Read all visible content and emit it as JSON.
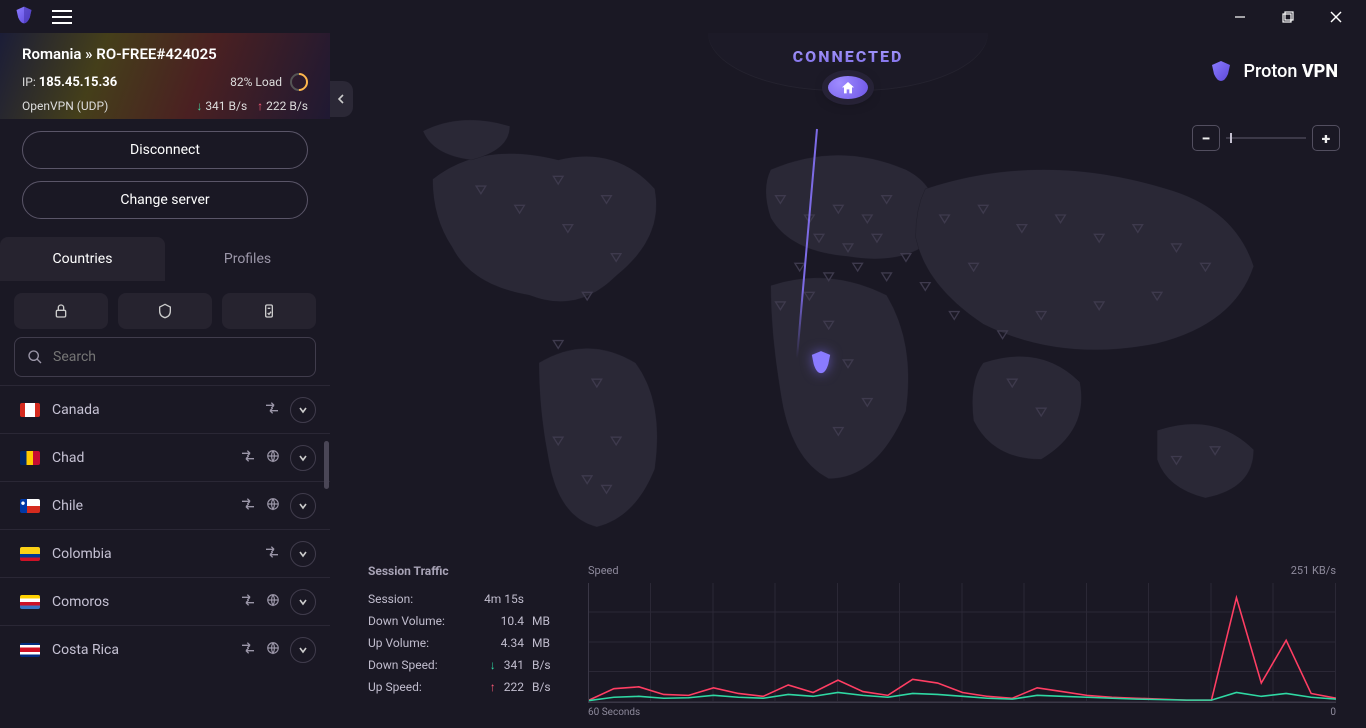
{
  "window": {
    "title": "Proton VPN"
  },
  "status": {
    "label": "CONNECTED",
    "breadcrumb_prefix": "Romania",
    "breadcrumb_sep": "»",
    "breadcrumb_server": "RO-FREE#424025",
    "ip_label": "IP:",
    "ip": "185.45.15.36",
    "load_text": "82% Load",
    "protocol": "OpenVPN (UDP)",
    "down_speed": "341 B/s",
    "up_speed": "222 B/s"
  },
  "buttons": {
    "disconnect": "Disconnect",
    "change_server": "Change server"
  },
  "tabs": {
    "countries": "Countries",
    "profiles": "Profiles",
    "active": "countries"
  },
  "filters": [
    "lock",
    "shield",
    "bolt"
  ],
  "search": {
    "placeholder": "Search"
  },
  "countries": [
    {
      "name": "Canada",
      "flag": "linear-gradient(90deg,#d52b1e 25%, #fff 25% 75%, #d52b1e 75%)",
      "p2p": true,
      "globe": false
    },
    {
      "name": "Chad",
      "flag": "linear-gradient(90deg,#002664 33%, #fecb00 33% 66%, #c60c30 66%)",
      "p2p": true,
      "globe": true
    },
    {
      "name": "Chile",
      "flag": "linear-gradient(180deg,#fff 50%, #d52b1e 50%)",
      "flag_overlay": "radial-gradient(circle at 15% 30%, #fff 1.5px, transparent 2px), linear-gradient(90deg,#0039a6 35%, transparent 35%)",
      "p2p": true,
      "globe": true
    },
    {
      "name": "Colombia",
      "flag": "linear-gradient(180deg,#fcd116 50%, #003893 50% 75%, #ce1126 75%)",
      "p2p": true,
      "globe": false
    },
    {
      "name": "Comoros",
      "flag": "linear-gradient(180deg,#ffd100 25%, #fff 25% 50%, #ce1126 50% 75%, #3a75c4 75%), linear-gradient(110deg,#3d8e33 35%, transparent 35%)",
      "p2p": true,
      "globe": true
    },
    {
      "name": "Costa Rica",
      "flag": "linear-gradient(180deg,#002b7f 16%, #fff 16% 33%, #ce1126 33% 66%, #fff 66% 83%, #002b7f 83%)",
      "p2p": true,
      "globe": true
    }
  ],
  "zoom": {
    "minus": "−",
    "plus": "+"
  },
  "brand": {
    "a": "Proton",
    "b": "VPN"
  },
  "traffic": {
    "title": "Session Traffic",
    "rows": [
      {
        "label": "Session:",
        "value": "4m 15s",
        "unit": ""
      },
      {
        "label": "Down Volume:",
        "value": "10.4",
        "unit": "MB"
      },
      {
        "label": "Up Volume:",
        "value": "4.34",
        "unit": "MB"
      },
      {
        "label": "Down Speed:",
        "value": "341",
        "unit": "B/s",
        "arrow": "down"
      },
      {
        "label": "Up Speed:",
        "value": "222",
        "unit": "B/s",
        "arrow": "up"
      }
    ]
  },
  "chart": {
    "speed_label": "Speed",
    "max_label": "251  KB/s",
    "x_left": "60 Seconds",
    "x_right": "0"
  },
  "chart_data": {
    "type": "line",
    "xlabel": "Seconds ago",
    "ylabel": "Speed",
    "ylim": [
      0,
      251
    ],
    "y_unit": "KB/s",
    "x": [
      60,
      58,
      56,
      54,
      52,
      50,
      48,
      46,
      44,
      42,
      40,
      38,
      36,
      34,
      32,
      30,
      28,
      26,
      24,
      22,
      20,
      18,
      16,
      14,
      12,
      10,
      8,
      6,
      4,
      2,
      0
    ],
    "series": [
      {
        "name": "Down",
        "color": "#ff3e63",
        "values": [
          4,
          28,
          32,
          16,
          14,
          30,
          18,
          12,
          36,
          20,
          46,
          22,
          14,
          48,
          40,
          20,
          12,
          8,
          30,
          22,
          14,
          10,
          8,
          6,
          4,
          4,
          220,
          40,
          130,
          18,
          8
        ]
      },
      {
        "name": "Up",
        "color": "#2fd8a3",
        "values": [
          3,
          10,
          12,
          8,
          9,
          14,
          10,
          8,
          16,
          12,
          20,
          14,
          10,
          18,
          16,
          12,
          8,
          6,
          14,
          12,
          10,
          8,
          6,
          5,
          4,
          4,
          20,
          12,
          18,
          10,
          6
        ]
      }
    ]
  },
  "colors": {
    "accent": "#7d6be6",
    "down": "#2fd8a3",
    "up": "#ff3e63"
  }
}
